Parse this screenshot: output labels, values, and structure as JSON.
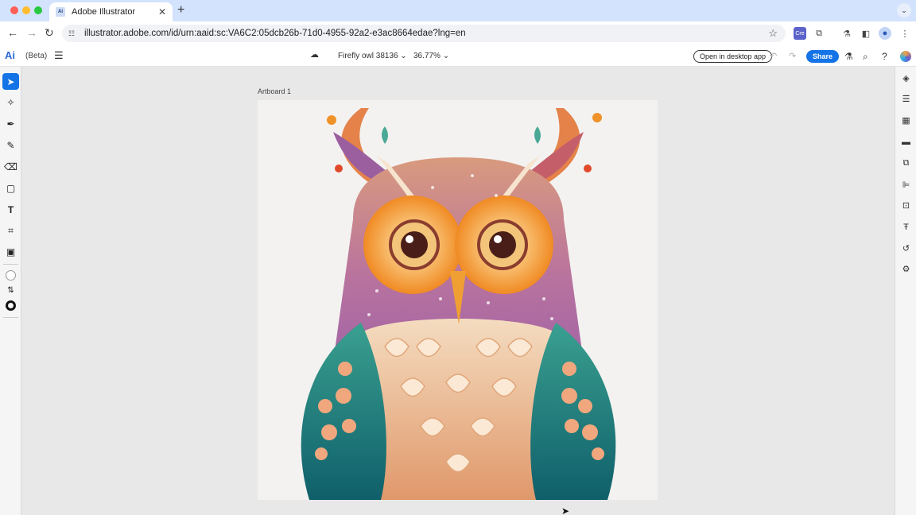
{
  "browser": {
    "tab_title": "Adobe Illustrator",
    "tab_favicon": "Ai",
    "url": "illustrator.adobe.com/id/urn:aaid:sc:VA6C2:05dcb26b-71d0-4955-92a2-e3ac8664edae?lng=en",
    "traffic_colors": [
      "#ff5f57",
      "#febc2e",
      "#28c840"
    ]
  },
  "app": {
    "logo": "Ai",
    "beta": "(Beta)",
    "document_name": "Firefly owl 38136",
    "zoom": "36.77%",
    "open_desktop": "Open in desktop app",
    "share": "Share",
    "accent": "#1473e6"
  },
  "canvas": {
    "artboard_label": "Artboard 1"
  },
  "left_tools": [
    {
      "name": "selection-tool",
      "icon": "arrow-icon",
      "selected": true
    },
    {
      "name": "direct-select-tool",
      "icon": "magic-icon"
    },
    {
      "name": "pen-tool",
      "icon": "pen-icon"
    },
    {
      "name": "pencil-tool",
      "icon": "pencil-icon"
    },
    {
      "name": "eraser-tool",
      "icon": "eraser-icon"
    },
    {
      "name": "rectangle-tool",
      "icon": "rectangle-icon"
    },
    {
      "name": "type-tool",
      "icon": "type-icon"
    },
    {
      "name": "crop-tool",
      "icon": "crop-icon"
    },
    {
      "name": "image-trace-tool",
      "icon": "image-icon"
    },
    {
      "name": "fill-swatch",
      "icon": "fill-icon"
    },
    {
      "name": "swap-colors",
      "icon": "swap-icon"
    },
    {
      "name": "stroke-swatch",
      "icon": "stroke-icon"
    }
  ],
  "right_tools": [
    "layers-icon",
    "properties-icon",
    "libraries-icon",
    "comments-icon",
    "pathfinder-icon",
    "align-icon",
    "transform-icon",
    "type-panel-icon",
    "history-icon",
    "settings-icon"
  ]
}
